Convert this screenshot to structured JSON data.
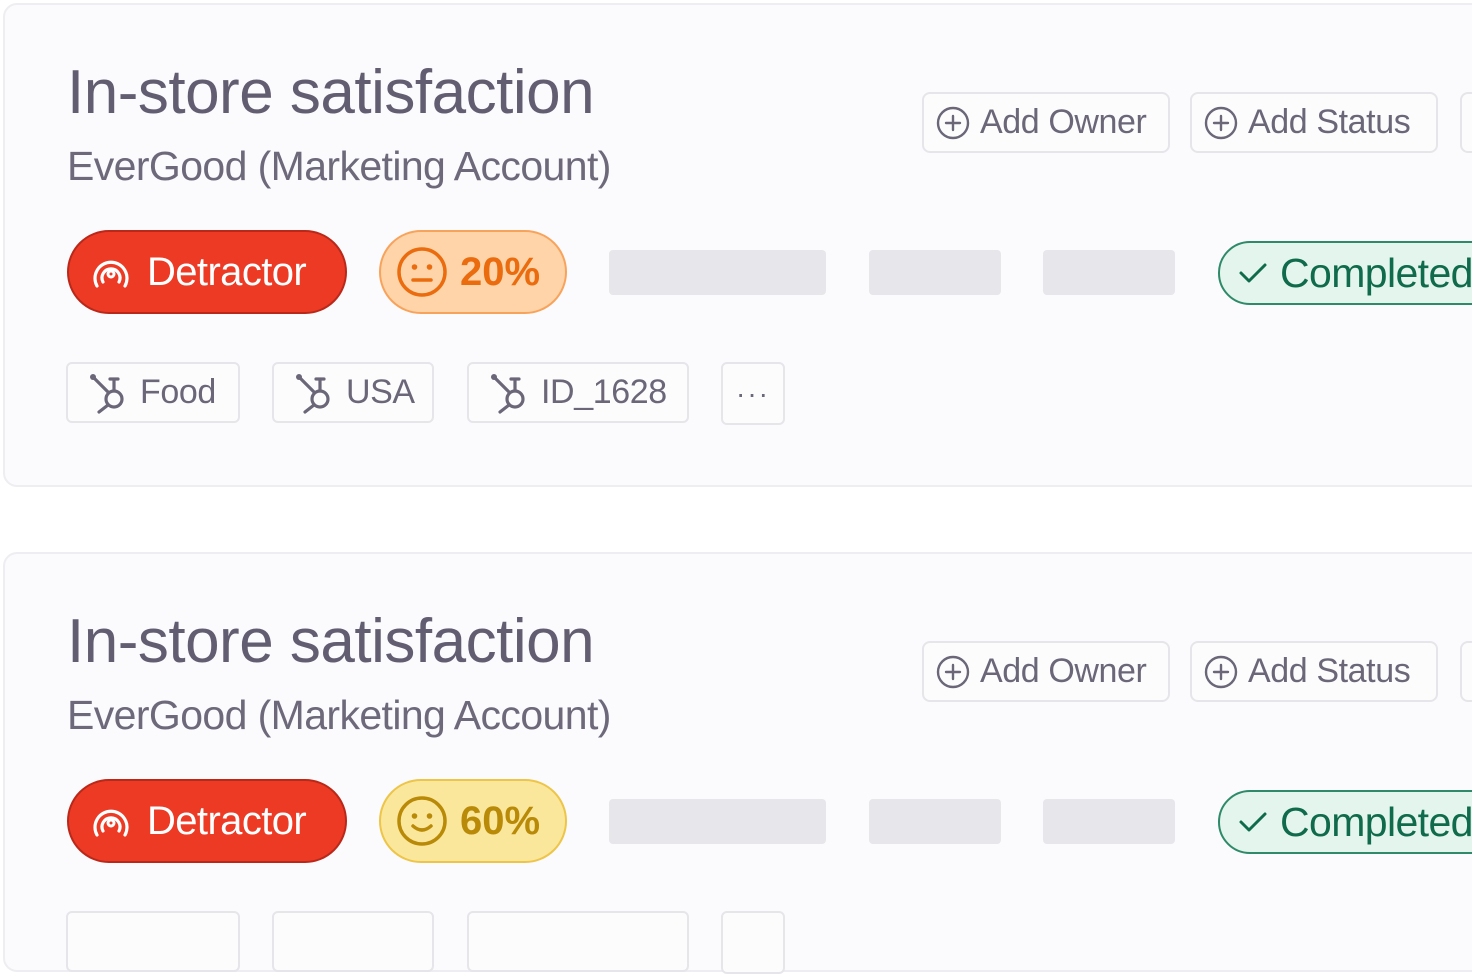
{
  "cards": [
    {
      "title": "In-store satisfaction",
      "subtitle": "EverGood (Marketing Account)",
      "add_owner_label": "Add Owner",
      "add_status_label": "Add Status",
      "detractor_label": "Detractor",
      "score_label": "20%",
      "score_tone": "orange",
      "completed_label": "Completed",
      "tags": [
        "Food",
        "USA",
        "ID_1628"
      ],
      "more_label": "···"
    },
    {
      "title": "In-store satisfaction",
      "subtitle": "EverGood (Marketing Account)",
      "add_owner_label": "Add Owner",
      "add_status_label": "Add Status",
      "detractor_label": "Detractor",
      "score_label": "60%",
      "score_tone": "yellow",
      "completed_label": "Completed"
    }
  ],
  "colors": {
    "detractor": "#ec3a25",
    "score_orange": "#ea6c0e",
    "score_yellow": "#b98a08",
    "completed": "#0f6b4b",
    "title": "#625d70"
  },
  "icons": {
    "add": "plus-circle-icon",
    "detractor": "signal-icon",
    "score_neutral": "neutral-face-icon",
    "score_smile": "smile-face-icon",
    "completed": "check-icon",
    "tag": "hubspot-icon",
    "more": "ellipsis-icon"
  }
}
